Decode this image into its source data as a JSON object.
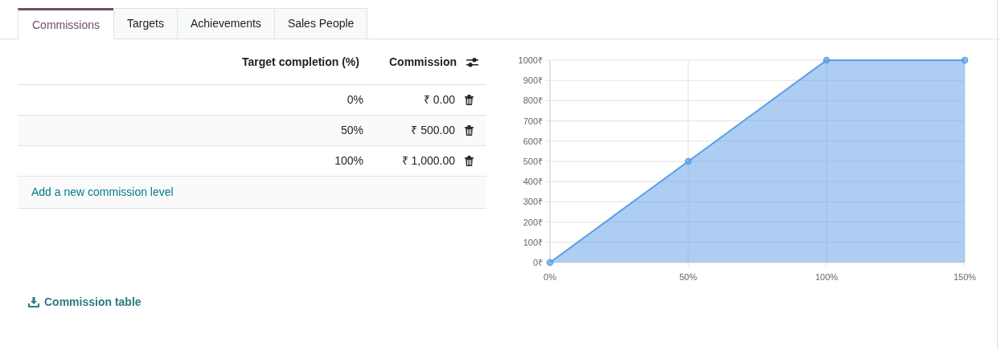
{
  "tabs": [
    {
      "label": "Commissions",
      "selected": true
    },
    {
      "label": "Targets",
      "selected": false
    },
    {
      "label": "Achievements",
      "selected": false
    },
    {
      "label": "Sales People",
      "selected": false
    }
  ],
  "table": {
    "columns": [
      "Target completion (%)",
      "Commission"
    ],
    "rows": [
      {
        "target": "0%",
        "commission": "₹ 0.00"
      },
      {
        "target": "50%",
        "commission": "₹ 500.00"
      },
      {
        "target": "100%",
        "commission": "₹ 1,000.00"
      }
    ],
    "add_line": "Add a new commission level"
  },
  "chart": {
    "chart_data": {
      "type": "area",
      "x": [
        0,
        50,
        100,
        150
      ],
      "series": [
        {
          "color": "#5b9ee6",
          "values": [
            0,
            500,
            1000,
            1000
          ]
        }
      ],
      "grid": true,
      "xlim": [
        0,
        150
      ],
      "ylim": [
        0,
        1000
      ],
      "xticks": [
        {
          "value": 0,
          "label": "0%"
        },
        {
          "value": 50,
          "label": "50%"
        },
        {
          "value": 100,
          "label": "100%"
        },
        {
          "value": 150,
          "label": "150%"
        }
      ],
      "yticks": [
        {
          "value": 0,
          "label": "0₹"
        },
        {
          "value": 100,
          "label": "100₹"
        },
        {
          "value": 200,
          "label": "200₹"
        },
        {
          "value": 300,
          "label": "300₹"
        },
        {
          "value": 400,
          "label": "400₹"
        },
        {
          "value": 500,
          "label": "500₹"
        },
        {
          "value": 600,
          "label": "600₹"
        },
        {
          "value": 700,
          "label": "700₹"
        },
        {
          "value": 800,
          "label": "800₹"
        },
        {
          "value": 900,
          "label": "900₹"
        },
        {
          "value": 1000,
          "label": "1000₹"
        }
      ]
    }
  },
  "download_link": "Commission table"
}
